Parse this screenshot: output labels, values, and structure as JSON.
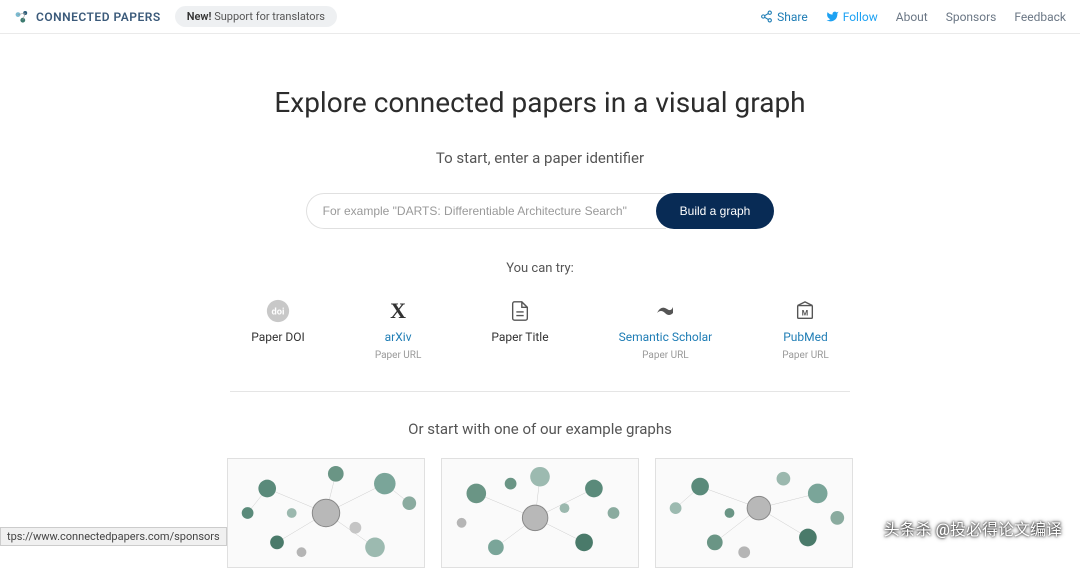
{
  "header": {
    "brand": "CONNECTED PAPERS",
    "news_prefix": "New!",
    "news_text": " Support for translators",
    "share": "Share",
    "follow": "Follow",
    "about": "About",
    "sponsors": "Sponsors",
    "feedback": "Feedback"
  },
  "main": {
    "title": "Explore connected papers in a visual graph",
    "subtitle": "To start, enter a paper identifier",
    "search_placeholder": "For example \"DARTS: Differentiable Architecture Search\"",
    "build_label": "Build a graph",
    "try_label": "You can try:",
    "try_items": [
      {
        "title": "Paper DOI",
        "sub": "",
        "link": false,
        "icon": "doi"
      },
      {
        "title": "arXiv",
        "sub": "Paper URL",
        "link": true,
        "icon": "arxiv"
      },
      {
        "title": "Paper Title",
        "sub": "",
        "link": false,
        "icon": "doc"
      },
      {
        "title": "Semantic Scholar",
        "sub": "Paper URL",
        "link": true,
        "icon": "scholar"
      },
      {
        "title": "PubMed",
        "sub": "Paper URL",
        "link": true,
        "icon": "pubmed"
      }
    ],
    "examples_title": "Or start with one of our example graphs"
  },
  "status_url": "tps://www.connectedpapers.com/sponsors",
  "watermark": "头条杀 @投必得论文编译"
}
